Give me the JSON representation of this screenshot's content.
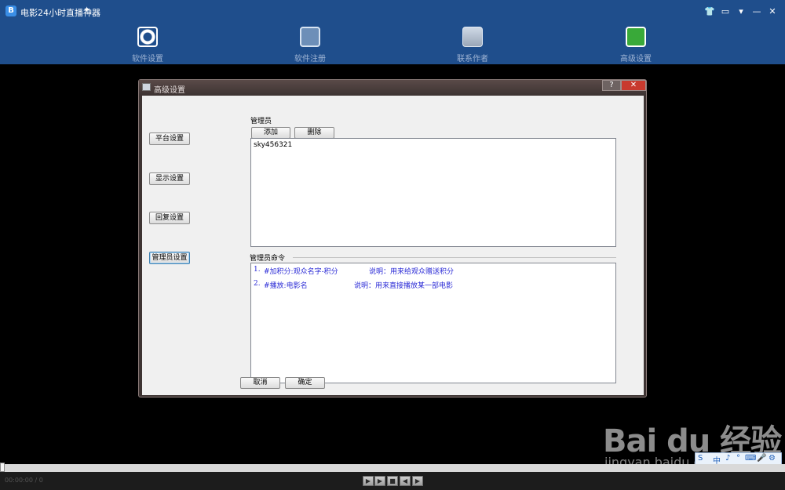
{
  "app": {
    "title": "电影24小时直播神器",
    "logo_glyph": "B",
    "pin_glyph": "✦",
    "window_controls": [
      "👕",
      "▭",
      "▾",
      "—",
      "✕"
    ]
  },
  "nav": {
    "items": [
      {
        "label": "软件设置",
        "icon": "gear-icon"
      },
      {
        "label": "软件注册",
        "icon": "register-icon"
      },
      {
        "label": "联系作者",
        "icon": "contact-icon"
      },
      {
        "label": "高级设置",
        "icon": "advanced-icon"
      }
    ]
  },
  "dialog": {
    "title": "高级设置",
    "help_glyph": "?",
    "close_glyph": "✕",
    "side_buttons": [
      "平台设置",
      "显示设置",
      "回复设置",
      "管理员设置"
    ],
    "admin_label": "管理员",
    "add_label": "添加",
    "delete_label": "删除",
    "admin_list": [
      "sky456321"
    ],
    "command_label": "管理员命令",
    "commands": [
      {
        "num": "1.",
        "text": "#加积分:观众名字-积分",
        "desc": "说明：用来给观众赠送积分"
      },
      {
        "num": "2.",
        "text": "#播放:电影名",
        "desc": "说明：用来直接播放某一部电影"
      }
    ],
    "cancel_label": "取消",
    "ok_label": "确定"
  },
  "player": {
    "time": "00:00:00 / 0",
    "controls": [
      "▶",
      "▶",
      "■",
      "◀",
      "▶"
    ]
  },
  "ime": {
    "items": [
      "S",
      "中",
      "♪",
      "°",
      "⌨",
      "🎤",
      "⚙"
    ]
  },
  "watermark": {
    "logo": "Bai du 经验",
    "url": "jingyan.baidu.com"
  }
}
